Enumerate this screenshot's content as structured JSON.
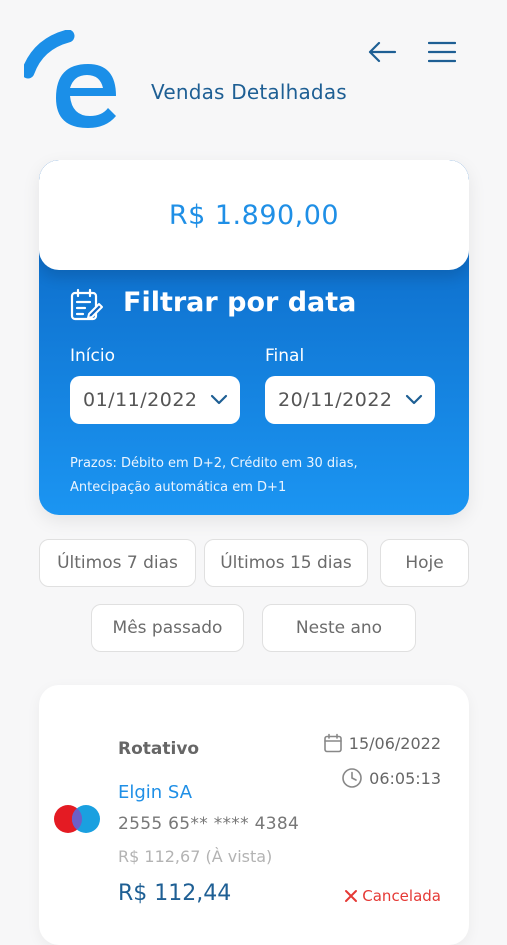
{
  "header": {
    "title": "Vendas Detalhadas",
    "back_icon": "arrow-left-icon",
    "menu_icon": "hamburger-menu-icon"
  },
  "balance": {
    "value": "R$ 1.890,00"
  },
  "filter": {
    "title": "Filtrar por data",
    "icon": "calendar-edit-icon",
    "start": {
      "label": "Início",
      "value": "01/11/2022"
    },
    "end": {
      "label": "Final",
      "value": "20/11/2022"
    },
    "note_line1": "Prazos: Débito em D+2, Crédito em 30 dias,",
    "note_line2": "Antecipação automática em D+1"
  },
  "quick_filters": [
    {
      "label": "Últimos 7 dias"
    },
    {
      "label": "Últimos 15 dias"
    },
    {
      "label": "Hoje"
    },
    {
      "label": "Mês passado"
    },
    {
      "label": "Neste ano"
    }
  ],
  "transaction": {
    "type": "Rotativo",
    "merchant": "Elgin SA",
    "card_number": "2555 65** **** 4384",
    "installment": "R$ 112,67 (À vista)",
    "amount": "R$ 112,44",
    "date": "15/06/2022",
    "time": "06:05:13",
    "status": "Cancelada",
    "card_brand": "maestro"
  },
  "colors": {
    "brand_blue": "#1f8fe6",
    "dark_blue": "#0a63c0",
    "title_blue": "#1e5f94",
    "cancel_red": "#e53935"
  }
}
